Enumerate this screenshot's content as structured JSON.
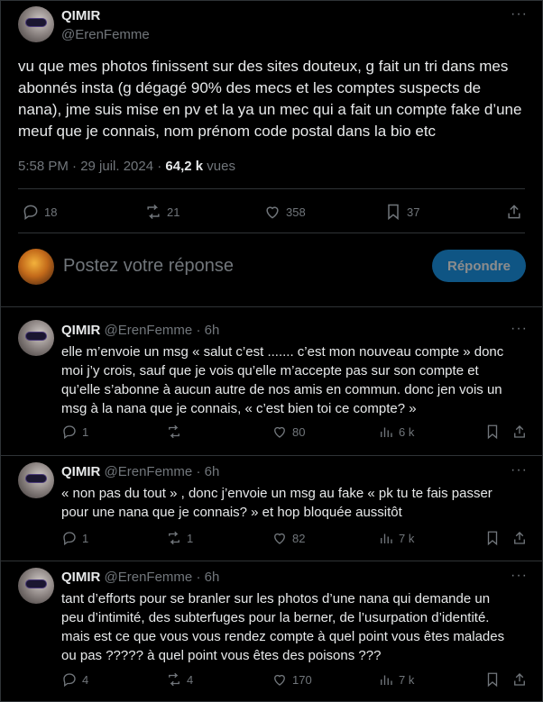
{
  "main_tweet": {
    "name": "QIMIR",
    "handle": "@ErenFemme",
    "text": "vu que mes photos finissent sur des sites douteux, g fait un tri dans mes abonnés insta (g dégagé 90% des mecs et les comptes suspects de nana), jme suis mise en pv et la ya un mec qui a fait un compte fake d’une meuf que je connais, nom prénom code postal dans la bio etc",
    "time": "5:58 PM · 29 juil. 2024 · ",
    "views_count": "64,2 k",
    "views_label": " vues",
    "replies": "18",
    "reposts": "21",
    "likes": "358",
    "bookmarks": "37"
  },
  "reply_box": {
    "placeholder": "Postez votre réponse",
    "button": "Répondre"
  },
  "thread": [
    {
      "name": "QIMIR",
      "handle": "@ErenFemme",
      "age": "· 6h",
      "text": "elle m’envoie un msg « salut c’est ....... c’est mon nouveau compte » donc moi j’y crois, sauf que je vois qu’elle m’accepte pas sur son compte et qu’elle s’abonne à aucun autre de nos amis en commun. donc jen vois un msg à la nana que je connais, « c’est bien toi ce compte? »",
      "replies": "1",
      "reposts": "",
      "likes": "80",
      "views": "6 k"
    },
    {
      "name": "QIMIR",
      "handle": "@ErenFemme",
      "age": "· 6h",
      "text": "« non pas du tout » , donc j’envoie un msg au fake « pk tu te fais passer pour une nana que je connais? » et hop bloquée aussitôt",
      "replies": "1",
      "reposts": "1",
      "likes": "82",
      "views": "7 k"
    },
    {
      "name": "QIMIR",
      "handle": "@ErenFemme",
      "age": "· 6h",
      "text": "tant d’efforts pour se branler sur les photos d’une nana qui demande un peu d’intimité, des subterfuges pour la berner, de l’usurpation d’identité. mais est ce que vous vous rendez compte à quel point vous êtes malades ou pas ????? à quel point vous êtes des poisons ???",
      "replies": "4",
      "reposts": "4",
      "likes": "170",
      "views": "7 k"
    }
  ],
  "icons": [
    "reply-icon",
    "repost-icon",
    "like-icon",
    "views-icon",
    "bookmark-icon",
    "share-icon",
    "more-icon"
  ]
}
